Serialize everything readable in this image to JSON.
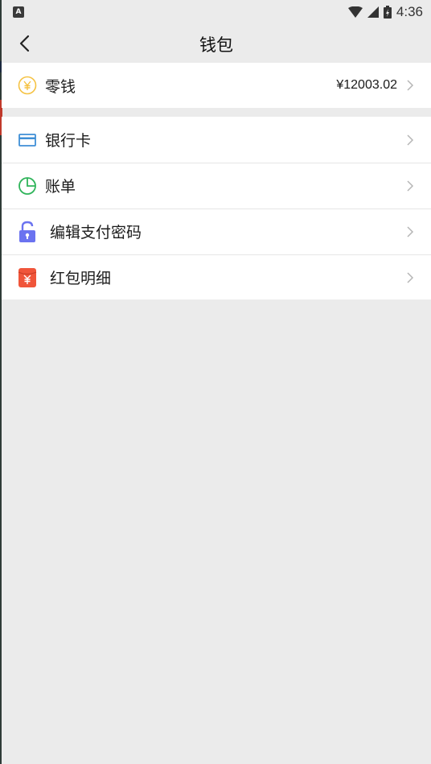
{
  "status_bar": {
    "notification_icon_letter": "A",
    "time": "4:36"
  },
  "header": {
    "title": "钱包"
  },
  "wallet": {
    "change": {
      "label": "零钱",
      "amount": "¥12003.02",
      "icon": "yuan-coin-icon"
    }
  },
  "menu": {
    "items": [
      {
        "label": "银行卡",
        "icon": "bank-card-icon"
      },
      {
        "label": "账单",
        "icon": "pie-chart-icon"
      },
      {
        "label": "编辑支付密码",
        "icon": "lock-icon"
      },
      {
        "label": "红包明细",
        "icon": "red-envelope-icon"
      }
    ]
  },
  "colors": {
    "background": "#ebebeb",
    "coin": "#f5c242",
    "card": "#3f8fd6",
    "bill": "#2fb45a",
    "lock": "#6b73f0",
    "red_envelope": "#f0553a"
  }
}
